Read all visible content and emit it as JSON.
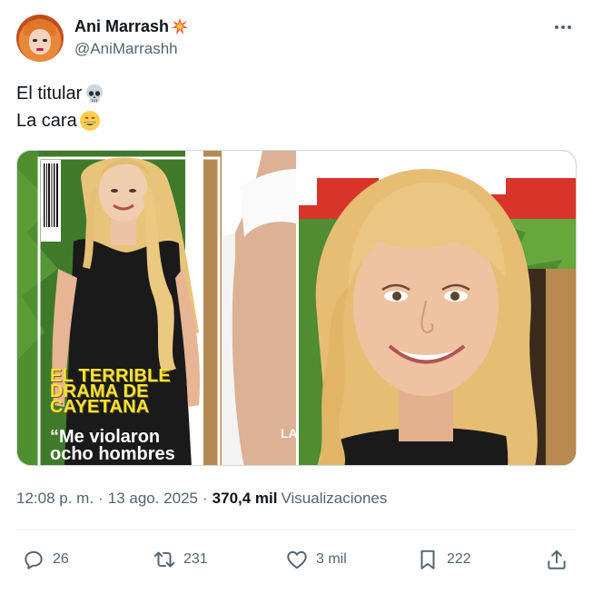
{
  "author": {
    "display_name": "Ani Marrash",
    "name_emoji": "collision-emoji",
    "handle": "@AniMarrashh"
  },
  "tweet": {
    "line1": "El titular",
    "line1_emoji": "skull-emoji",
    "line2": "La cara",
    "line2_emoji": "grinning-face-emoji"
  },
  "media": {
    "cover_headline": [
      "EL TERRIBLE",
      "DRAMA DE",
      "CAYETANA"
    ],
    "cover_quote": [
      "“Me violaron",
      "ocho hombres"
    ],
    "cover_tag": "LA"
  },
  "meta": {
    "time": "12:08 p. m.",
    "date": "13 ago. 2025",
    "views_count": "370,4 mil",
    "views_label": "Visualizaciones",
    "separator": "·"
  },
  "actions": {
    "replies": "26",
    "reposts": "231",
    "likes": "3 mil",
    "bookmarks": "222"
  },
  "colors": {
    "text_primary": "#0f1419",
    "text_secondary": "#536471",
    "border": "#cfd9de",
    "divider": "#eff3f4"
  }
}
